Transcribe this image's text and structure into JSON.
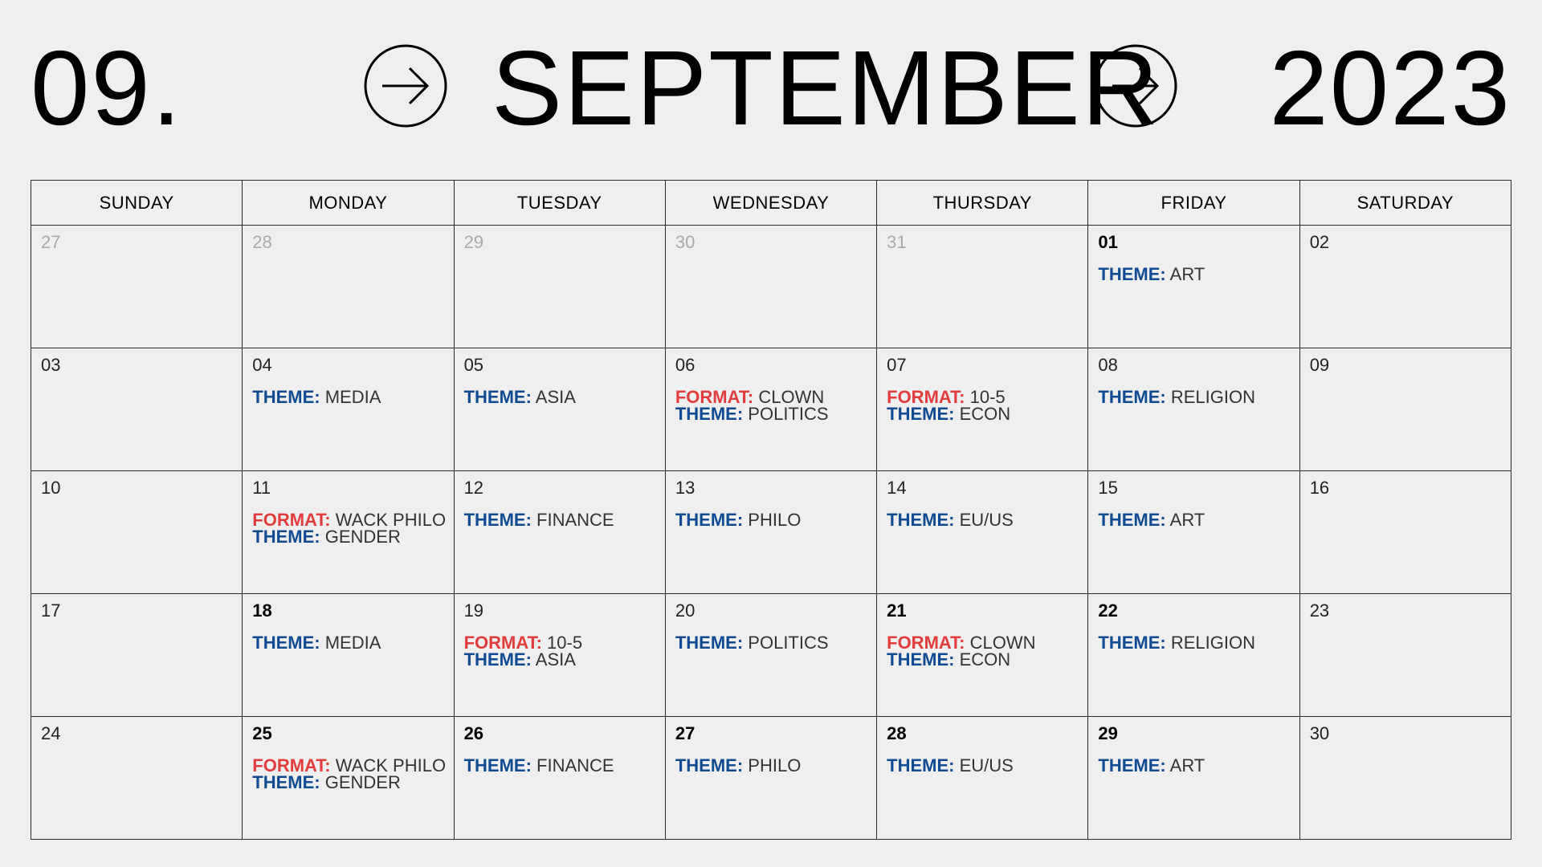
{
  "header": {
    "month_number": "09.",
    "month_name": "SEPTEMBER",
    "year": "2023"
  },
  "weekdays": [
    "SUNDAY",
    "MONDAY",
    "TUESDAY",
    "WEDNESDAY",
    "THURSDAY",
    "FRIDAY",
    "SATURDAY"
  ],
  "colors": {
    "theme": "#0f4a92",
    "format": "#e23c3c",
    "muted": "#a9a9a9"
  },
  "weeks": [
    [
      {
        "day": "27",
        "muted": true,
        "events": []
      },
      {
        "day": "28",
        "muted": true,
        "events": []
      },
      {
        "day": "29",
        "muted": true,
        "events": []
      },
      {
        "day": "30",
        "muted": true,
        "events": []
      },
      {
        "day": "31",
        "muted": true,
        "events": []
      },
      {
        "day": "01",
        "bold": true,
        "events": [
          {
            "type": "theme",
            "label": "THEME:",
            "value": "ART"
          }
        ]
      },
      {
        "day": "02",
        "events": []
      }
    ],
    [
      {
        "day": "03",
        "events": []
      },
      {
        "day": "04",
        "events": [
          {
            "type": "theme",
            "label": "THEME:",
            "value": "MEDIA"
          }
        ]
      },
      {
        "day": "05",
        "events": [
          {
            "type": "theme",
            "label": "THEME:",
            "value": "ASIA"
          }
        ]
      },
      {
        "day": "06",
        "events": [
          {
            "type": "format",
            "label": "FORMAT:",
            "value": "CLOWN"
          },
          {
            "type": "theme",
            "label": "THEME:",
            "value": "POLITICS"
          }
        ]
      },
      {
        "day": "07",
        "events": [
          {
            "type": "format",
            "label": "FORMAT:",
            "value": "10-5"
          },
          {
            "type": "theme",
            "label": "THEME:",
            "value": "ECON"
          }
        ]
      },
      {
        "day": "08",
        "events": [
          {
            "type": "theme",
            "label": "THEME:",
            "value": "RELIGION"
          }
        ]
      },
      {
        "day": "09",
        "events": []
      }
    ],
    [
      {
        "day": "10",
        "events": []
      },
      {
        "day": "11",
        "events": [
          {
            "type": "format",
            "label": "FORMAT:",
            "value": "WACK PHILO"
          },
          {
            "type": "theme",
            "label": "THEME:",
            "value": "GENDER"
          }
        ]
      },
      {
        "day": "12",
        "events": [
          {
            "type": "theme",
            "label": "THEME:",
            "value": "FINANCE"
          }
        ]
      },
      {
        "day": "13",
        "events": [
          {
            "type": "theme",
            "label": "THEME:",
            "value": "PHILO"
          }
        ]
      },
      {
        "day": "14",
        "events": [
          {
            "type": "theme",
            "label": "THEME:",
            "value": "EU/US"
          }
        ]
      },
      {
        "day": "15",
        "events": [
          {
            "type": "theme",
            "label": "THEME:",
            "value": "ART"
          }
        ]
      },
      {
        "day": "16",
        "events": []
      }
    ],
    [
      {
        "day": "17",
        "events": []
      },
      {
        "day": "18",
        "bold": true,
        "events": [
          {
            "type": "theme",
            "label": "THEME:",
            "value": "MEDIA"
          }
        ]
      },
      {
        "day": "19",
        "events": [
          {
            "type": "format",
            "label": "FORMAT:",
            "value": "10-5"
          },
          {
            "type": "theme",
            "label": "THEME:",
            "value": "ASIA"
          }
        ]
      },
      {
        "day": "20",
        "events": [
          {
            "type": "theme",
            "label": "THEME:",
            "value": "POLITICS"
          }
        ]
      },
      {
        "day": "21",
        "bold": true,
        "events": [
          {
            "type": "format",
            "label": "FORMAT:",
            "value": "CLOWN"
          },
          {
            "type": "theme",
            "label": "THEME:",
            "value": "ECON"
          }
        ]
      },
      {
        "day": "22",
        "bold": true,
        "events": [
          {
            "type": "theme",
            "label": "THEME:",
            "value": "RELIGION"
          }
        ]
      },
      {
        "day": "23",
        "events": []
      }
    ],
    [
      {
        "day": "24",
        "events": []
      },
      {
        "day": "25",
        "bold": true,
        "events": [
          {
            "type": "format",
            "label": "FORMAT:",
            "value": "WACK PHILO"
          },
          {
            "type": "theme",
            "label": "THEME:",
            "value": "GENDER"
          }
        ]
      },
      {
        "day": "26",
        "bold": true,
        "events": [
          {
            "type": "theme",
            "label": "THEME:",
            "value": "FINANCE"
          }
        ]
      },
      {
        "day": "27",
        "bold": true,
        "events": [
          {
            "type": "theme",
            "label": "THEME:",
            "value": "PHILO"
          }
        ]
      },
      {
        "day": "28",
        "bold": true,
        "events": [
          {
            "type": "theme",
            "label": "THEME:",
            "value": "EU/US"
          }
        ]
      },
      {
        "day": "29",
        "bold": true,
        "events": [
          {
            "type": "theme",
            "label": "THEME:",
            "value": "ART"
          }
        ]
      },
      {
        "day": "30",
        "events": []
      }
    ]
  ]
}
